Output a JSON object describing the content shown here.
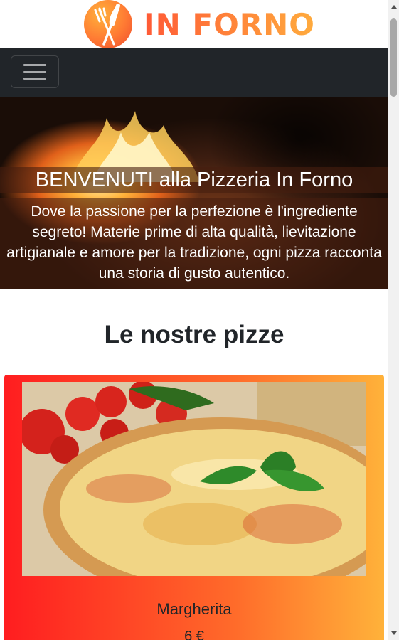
{
  "header": {
    "logo_text": "IN FORNO",
    "logo_icon": "fork-knife-icon"
  },
  "navbar": {
    "toggler_icon": "hamburger-menu-icon"
  },
  "hero": {
    "title": "BENVENUTI alla Pizzeria In Forno",
    "subtitle": "Dove la passione per la perfezione è l'ingrediente segreto! Materie prime di alta qualità, lievitazione artigianale e amore per la tradizione, ogni pizza racconta una storia di gusto autentico."
  },
  "menu": {
    "heading": "Le nostre pizze",
    "items": [
      {
        "name": "Margherita",
        "price": "6 €"
      }
    ]
  },
  "colors": {
    "accent_start": "#ff1d20",
    "accent_end": "#ffb23a",
    "navbar": "#212529"
  }
}
